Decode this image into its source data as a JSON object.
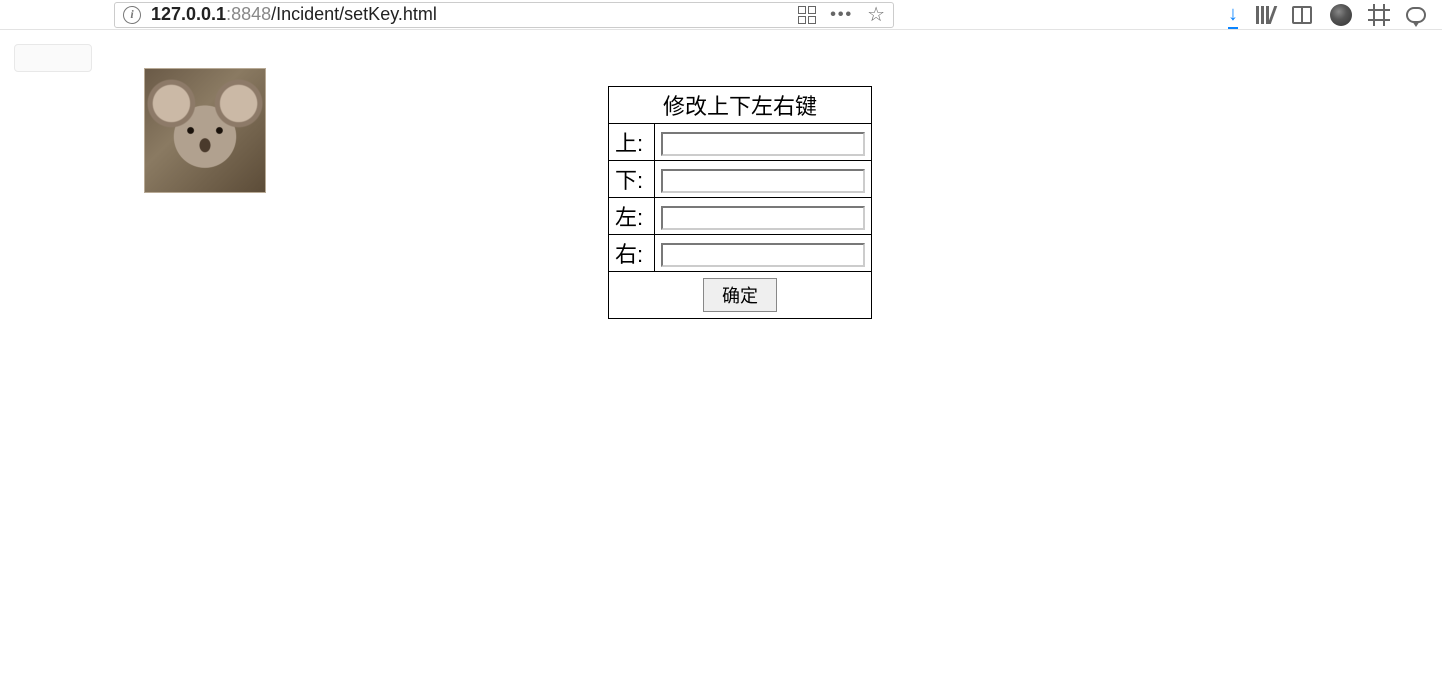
{
  "browser": {
    "url_host": "127.0.0.1",
    "url_port": ":8848",
    "url_path": "/Incident/setKey.html"
  },
  "page": {
    "badge": "",
    "table_title": "修改上下左右键",
    "rows": [
      {
        "label": "上:",
        "value": ""
      },
      {
        "label": "下:",
        "value": ""
      },
      {
        "label": "左:",
        "value": ""
      },
      {
        "label": "右:",
        "value": ""
      }
    ],
    "submit_label": "确定"
  }
}
